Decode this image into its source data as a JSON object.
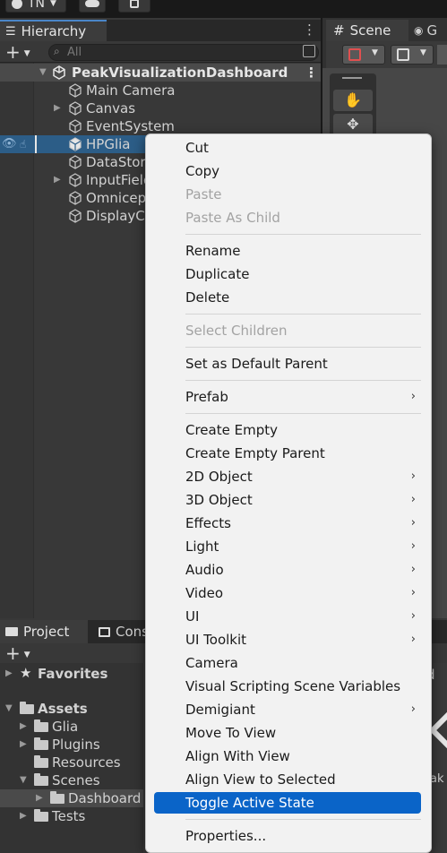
{
  "toolbar": {
    "account_label": "TN",
    "cloud_icon": "cloud-icon",
    "collab_icon": "collab-icon"
  },
  "hierarchy": {
    "tab_label": "Hierarchy",
    "search_placeholder": "All",
    "scene_name": "PeakVisualizationDashboard",
    "items": [
      {
        "label": "Main Camera",
        "expandable": false
      },
      {
        "label": "Canvas",
        "expandable": true
      },
      {
        "label": "EventSystem",
        "expandable": false
      },
      {
        "label": "HPGlia",
        "expandable": false
      },
      {
        "label": "DataStore",
        "expandable": false
      },
      {
        "label": "InputField",
        "expandable": true
      },
      {
        "label": "Omnicept",
        "expandable": false
      },
      {
        "label": "DisplayC",
        "expandable": false
      }
    ]
  },
  "scene": {
    "tab_label": "Scene",
    "game_tab_label": "G"
  },
  "project": {
    "tab_label": "Project",
    "console_tab_label": "Cons",
    "favorites_label": "Favorites",
    "assets_label": "Assets",
    "folders": [
      "Glia",
      "Plugins",
      "Resources",
      "Scenes",
      "Dashboard",
      "Tests"
    ],
    "right_partial_text_1": "d",
    "right_partial_text_2": "eak"
  },
  "context_menu": {
    "items": [
      {
        "label": "Cut",
        "disabled": false,
        "submenu": false
      },
      {
        "label": "Copy",
        "disabled": false,
        "submenu": false
      },
      {
        "label": "Paste",
        "disabled": true,
        "submenu": false
      },
      {
        "label": "Paste As Child",
        "disabled": true,
        "submenu": false
      },
      {
        "label": "Rename",
        "disabled": false,
        "submenu": false
      },
      {
        "label": "Duplicate",
        "disabled": false,
        "submenu": false
      },
      {
        "label": "Delete",
        "disabled": false,
        "submenu": false
      },
      {
        "label": "Select Children",
        "disabled": true,
        "submenu": false
      },
      {
        "label": "Set as Default Parent",
        "disabled": false,
        "submenu": false
      },
      {
        "label": "Prefab",
        "disabled": false,
        "submenu": true
      },
      {
        "label": "Create Empty",
        "disabled": false,
        "submenu": false
      },
      {
        "label": "Create Empty Parent",
        "disabled": false,
        "submenu": false
      },
      {
        "label": "2D Object",
        "disabled": false,
        "submenu": true
      },
      {
        "label": "3D Object",
        "disabled": false,
        "submenu": true
      },
      {
        "label": "Effects",
        "disabled": false,
        "submenu": true
      },
      {
        "label": "Light",
        "disabled": false,
        "submenu": true
      },
      {
        "label": "Audio",
        "disabled": false,
        "submenu": true
      },
      {
        "label": "Video",
        "disabled": false,
        "submenu": true
      },
      {
        "label": "UI",
        "disabled": false,
        "submenu": true
      },
      {
        "label": "UI Toolkit",
        "disabled": false,
        "submenu": true
      },
      {
        "label": "Camera",
        "disabled": false,
        "submenu": false
      },
      {
        "label": "Visual Scripting Scene Variables",
        "disabled": false,
        "submenu": false
      },
      {
        "label": "Demigiant",
        "disabled": false,
        "submenu": true
      },
      {
        "label": "Move To View",
        "disabled": false,
        "submenu": false
      },
      {
        "label": "Align With View",
        "disabled": false,
        "submenu": false
      },
      {
        "label": "Align View to Selected",
        "disabled": false,
        "submenu": false
      },
      {
        "label": "Toggle Active State",
        "disabled": false,
        "submenu": false,
        "highlighted": true
      },
      {
        "label": "Properties...",
        "disabled": false,
        "submenu": false
      }
    ]
  },
  "colors": {
    "selection": "#2c5d87",
    "menu_highlight": "#0a64c8",
    "tab_accent": "#4a86c8"
  }
}
